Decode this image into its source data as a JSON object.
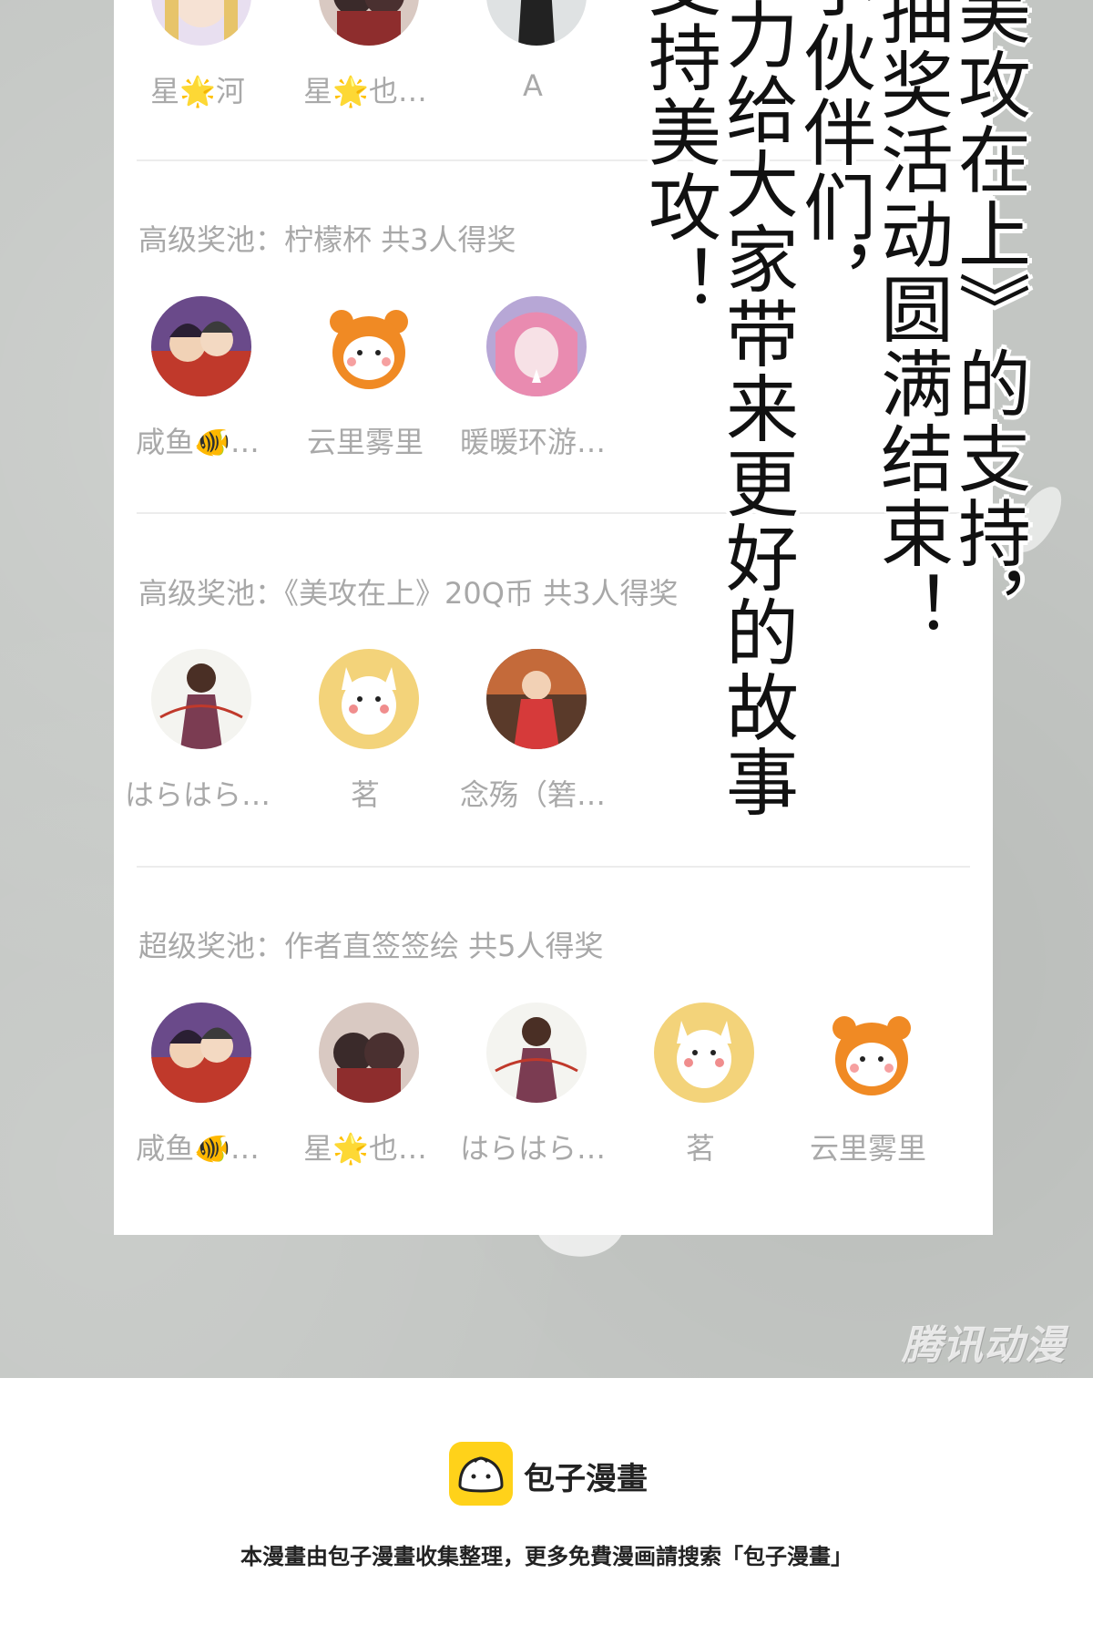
{
  "vertical_text": [
    "美攻在上》的支持，",
    "抽奖活动圆满结束！",
    "小伙伴们，",
    "努力给大家带来更好的故事",
    "支持美攻！"
  ],
  "pools": [
    {
      "title": "",
      "members": [
        {
          "name": "星🌟河",
          "icon": "anime-girl-avatar"
        },
        {
          "name": "星🌟也…",
          "icon": "couple-avatar"
        },
        {
          "name": "A",
          "icon": "dark-figure-avatar"
        }
      ]
    },
    {
      "title": "高级奖池：柠檬杯 共3人得奖",
      "members": [
        {
          "name": "咸鱼🐠…",
          "icon": "manga-couple-avatar"
        },
        {
          "name": "云里雾里",
          "icon": "orange-bear-avatar"
        },
        {
          "name": "暖暖环游…",
          "icon": "pink-hair-avatar"
        }
      ]
    },
    {
      "title": "高级奖池：《美攻在上》20Q币 共3人得奖",
      "members": [
        {
          "name": "はらはら…",
          "icon": "archer-girl-avatar"
        },
        {
          "name": "茗",
          "icon": "yellow-creature-avatar"
        },
        {
          "name": "念殇（箬…",
          "icon": "red-dress-avatar"
        }
      ]
    },
    {
      "title": "超级奖池：作者直签签绘 共5人得奖",
      "members": [
        {
          "name": "咸鱼🐠…",
          "icon": "manga-couple-avatar"
        },
        {
          "name": "星🌟也…",
          "icon": "couple-avatar"
        },
        {
          "name": "はらはら…",
          "icon": "archer-girl-avatar"
        },
        {
          "name": "茗",
          "icon": "yellow-creature-avatar"
        },
        {
          "name": "云里雾里",
          "icon": "orange-bear-avatar"
        }
      ]
    }
  ],
  "watermark": "腾讯动漫",
  "footer": {
    "brand_name": "包子漫畫",
    "note": "本漫畫由包子漫畫收集整理，更多免費漫画請搜索「包子漫畫」",
    "logo_icon": "bun-logo-icon",
    "logo_color": "#ffd21a"
  }
}
